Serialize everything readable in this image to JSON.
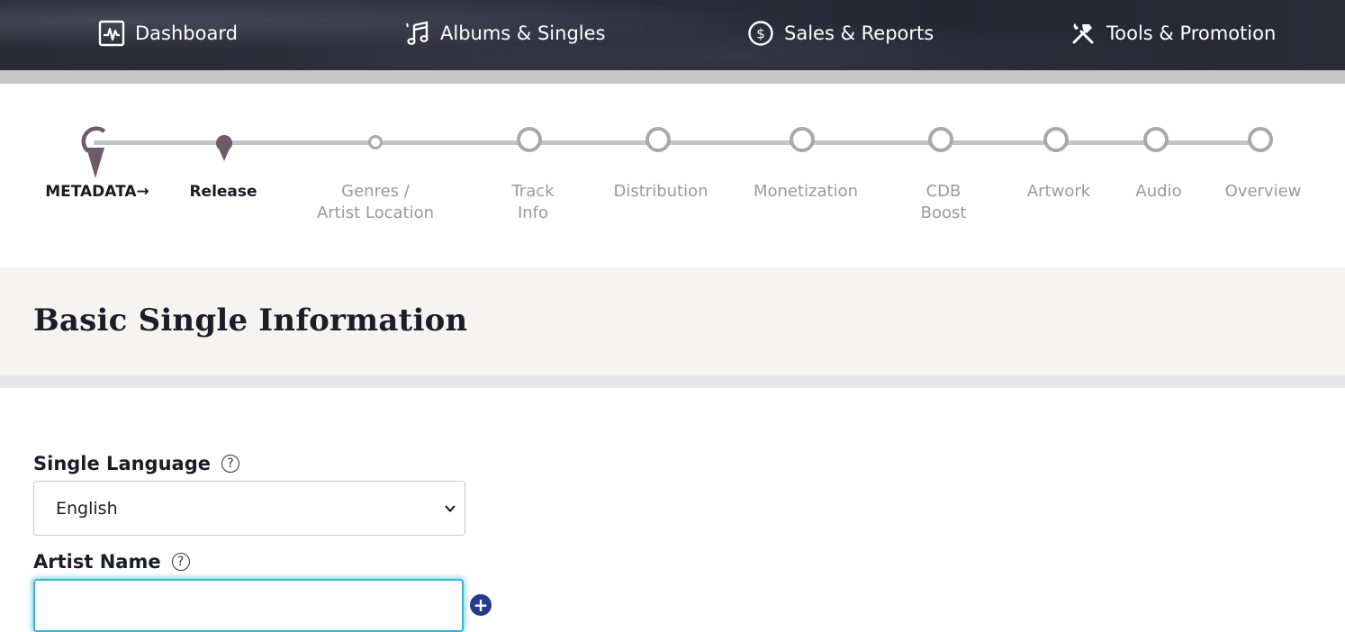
{
  "nav": {
    "items": [
      {
        "label": "Dashboard",
        "icon": "chart-pulse-icon"
      },
      {
        "label": "Albums & Singles",
        "icon": "music-notes-icon"
      },
      {
        "label": "Sales & Reports",
        "icon": "dollar-circle-icon"
      },
      {
        "label": "Tools & Promotion",
        "icon": "hammer-wrench-icon"
      }
    ]
  },
  "progress": {
    "current_section": "METADATA→",
    "steps": [
      {
        "label": "Release",
        "state": "current"
      },
      {
        "label": "Genres /\nArtist Location",
        "state": "next"
      },
      {
        "label": "Track\nInfo",
        "state": "upcoming"
      },
      {
        "label": "Distribution",
        "state": "upcoming"
      },
      {
        "label": "Monetization",
        "state": "upcoming"
      },
      {
        "label": "CDB\nBoost",
        "state": "upcoming"
      },
      {
        "label": "Artwork",
        "state": "upcoming"
      },
      {
        "label": "Audio",
        "state": "upcoming"
      },
      {
        "label": "Overview",
        "state": "upcoming"
      }
    ]
  },
  "section": {
    "title": "Basic Single Information"
  },
  "form": {
    "language": {
      "label": "Single Language",
      "help": "?",
      "value": "English"
    },
    "artist": {
      "label": "Artist Name",
      "help": "?",
      "value": "",
      "placeholder": "",
      "add": "+"
    }
  },
  "colors": {
    "accent": "#38b6c9",
    "marker": "#6e5a6c",
    "add_button": "#263a8f"
  }
}
